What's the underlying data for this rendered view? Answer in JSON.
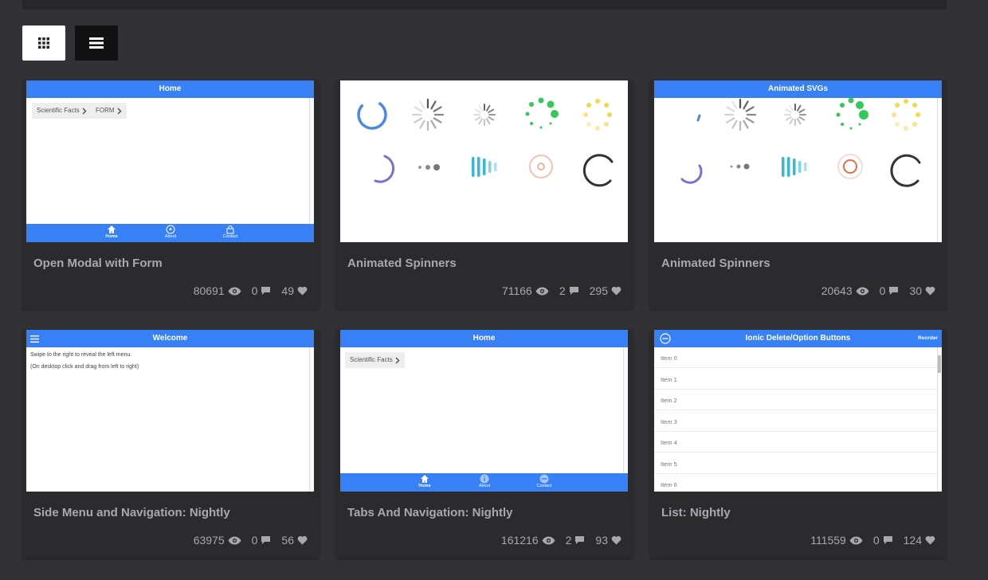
{
  "cards": [
    {
      "title": "Open Modal with Form",
      "views": "80691",
      "comments": "0",
      "likes": "49",
      "preview": {
        "header": "Home",
        "chips": [
          "Scientific Facts",
          "FORM"
        ],
        "tabs": [
          "Home",
          "About",
          "Contact"
        ]
      }
    },
    {
      "title": "Animated Spinners",
      "views": "71166",
      "comments": "2",
      "likes": "295"
    },
    {
      "title": "Animated Spinners",
      "views": "20643",
      "comments": "0",
      "likes": "30",
      "preview": {
        "header": "Animated SVGs"
      }
    },
    {
      "title": "Side Menu and Navigation: Nightly",
      "views": "63975",
      "comments": "0",
      "likes": "56",
      "preview": {
        "header": "Welcome",
        "lines": [
          "Swipe to the right to reveal the left menu.",
          "(On desktop click and drag from left to right)"
        ]
      }
    },
    {
      "title": "Tabs And Navigation: Nightly",
      "views": "161216",
      "comments": "2",
      "likes": "93",
      "preview": {
        "header": "Home",
        "chips": [
          "Scientific Facts"
        ],
        "tabs": [
          "Home",
          "About",
          "Contact"
        ]
      }
    },
    {
      "title": "List: Nightly",
      "views": "111559",
      "comments": "0",
      "likes": "124",
      "preview": {
        "header": "Ionic Delete/Option Buttons",
        "right_button": "Reorder",
        "items": [
          "Item 0",
          "Item 1",
          "Item 2",
          "Item 3",
          "Item 4",
          "Item 5",
          "Item 6"
        ]
      }
    }
  ],
  "icons": {
    "grid_view": "grid-icon",
    "list_view": "list-icon",
    "views": "eye-icon",
    "comments": "comment-icon",
    "likes": "heart-icon"
  },
  "colors": {
    "background": "#323136",
    "card": "#2b2b2e",
    "ionic_blue": "#3880f5",
    "text": "#a9a8ad"
  }
}
